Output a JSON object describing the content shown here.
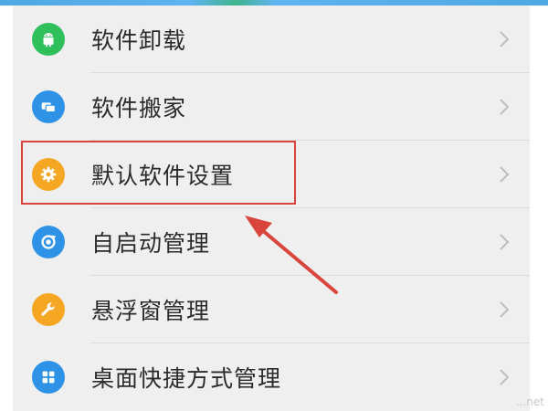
{
  "menu": {
    "items": [
      {
        "label": "软件卸载",
        "icon": "android-icon",
        "color": "#2fbf5b"
      },
      {
        "label": "软件搬家",
        "icon": "move-apps-icon",
        "color": "#2e93e6"
      },
      {
        "label": "默认软件设置",
        "icon": "gear-icon",
        "color": "#f5a623"
      },
      {
        "label": "自启动管理",
        "icon": "autostart-icon",
        "color": "#2e93e6"
      },
      {
        "label": "悬浮窗管理",
        "icon": "wrench-icon",
        "color": "#f5a623"
      },
      {
        "label": "桌面快捷方式管理",
        "icon": "grid-icon",
        "color": "#2e93e6"
      }
    ]
  },
  "annotation": {
    "highlight_color": "#d9453c"
  },
  "watermark": {
    "text": "...net"
  }
}
